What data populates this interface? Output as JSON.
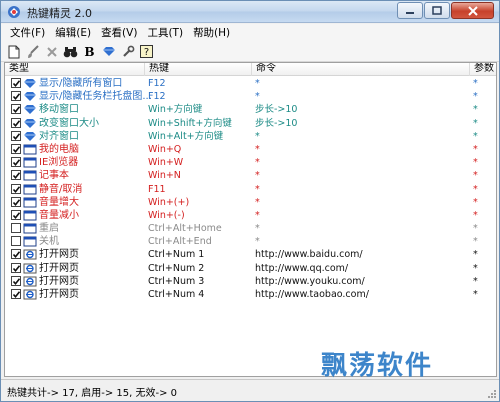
{
  "window": {
    "title": "热键精灵 2.0"
  },
  "menu": [
    "文件(F)",
    "编辑(E)",
    "查看(V)",
    "工具(T)",
    "帮助(H)"
  ],
  "toolbar": {
    "icons": [
      "new-file-icon",
      "brush-icon",
      "delete-icon",
      "find-icon",
      "bold-icon",
      "gem-icon",
      "wrench-icon",
      "help-icon"
    ],
    "bold_glyph": "B"
  },
  "columns": {
    "type": "类型",
    "hotkey": "热键",
    "command": "命令",
    "param": "参数"
  },
  "rows": [
    {
      "checked": true,
      "icon": "diamond-icon",
      "color": "#2a6fc4",
      "type": "显示/隐藏所有窗口",
      "hotkey": "F12",
      "command": "*",
      "param": "*"
    },
    {
      "checked": true,
      "icon": "diamond-icon",
      "color": "#2a6fc4",
      "type": "显示/隐藏任务栏托盘图...",
      "hotkey": "F12",
      "command": "*",
      "param": "*"
    },
    {
      "checked": true,
      "icon": "diamond-icon",
      "color": "#1c8b86",
      "type": "移动窗口",
      "hotkey": "Win+方向键",
      "command": "步长->10",
      "param": "*"
    },
    {
      "checked": true,
      "icon": "diamond-icon",
      "color": "#1c8b86",
      "type": "改变窗口大小",
      "hotkey": "Win+Shift+方向键",
      "command": "步长->10",
      "param": "*"
    },
    {
      "checked": true,
      "icon": "diamond-icon",
      "color": "#1c8b86",
      "type": "对齐窗口",
      "hotkey": "Win+Alt+方向键",
      "command": "*",
      "param": "*"
    },
    {
      "checked": true,
      "icon": "window-icon",
      "color": "#d42020",
      "type": "我的电脑",
      "hotkey": "Win+Q",
      "command": "*",
      "param": "*"
    },
    {
      "checked": true,
      "icon": "window-icon",
      "color": "#d42020",
      "type": "IE浏览器",
      "hotkey": "Win+W",
      "command": "*",
      "param": "*"
    },
    {
      "checked": true,
      "icon": "window-icon",
      "color": "#d42020",
      "type": "记事本",
      "hotkey": "Win+N",
      "command": "*",
      "param": "*"
    },
    {
      "checked": true,
      "icon": "window-icon",
      "color": "#d42020",
      "type": "静音/取消",
      "hotkey": "F11",
      "command": "*",
      "param": "*"
    },
    {
      "checked": true,
      "icon": "window-icon",
      "color": "#d42020",
      "type": "音量增大",
      "hotkey": "Win+(+)",
      "command": "*",
      "param": "*"
    },
    {
      "checked": true,
      "icon": "window-icon",
      "color": "#d42020",
      "type": "音量减小",
      "hotkey": "Win+(-)",
      "command": "*",
      "param": "*"
    },
    {
      "checked": false,
      "icon": "window-icon",
      "color": "#8a8a8a",
      "type": "重启",
      "hotkey": "Ctrl+Alt+Home",
      "command": "*",
      "param": "*"
    },
    {
      "checked": false,
      "icon": "window-icon",
      "color": "#8a8a8a",
      "type": "关机",
      "hotkey": "Ctrl+Alt+End",
      "command": "*",
      "param": "*"
    },
    {
      "checked": true,
      "icon": "ie-icon",
      "color": "#111111",
      "type": "打开网页",
      "hotkey": "Ctrl+Num 1",
      "command": "http://www.baidu.com/",
      "param": "*"
    },
    {
      "checked": true,
      "icon": "ie-icon",
      "color": "#111111",
      "type": "打开网页",
      "hotkey": "Ctrl+Num 2",
      "command": "http://www.qq.com/",
      "param": "*"
    },
    {
      "checked": true,
      "icon": "ie-icon",
      "color": "#111111",
      "type": "打开网页",
      "hotkey": "Ctrl+Num 3",
      "command": "http://www.youku.com/",
      "param": "*"
    },
    {
      "checked": true,
      "icon": "ie-icon",
      "color": "#111111",
      "type": "打开网页",
      "hotkey": "Ctrl+Num 4",
      "command": "http://www.taobao.com/",
      "param": "*"
    }
  ],
  "status": "热键共计-> 17, 启用-> 15, 无效-> 0",
  "watermark": "飘荡软件"
}
